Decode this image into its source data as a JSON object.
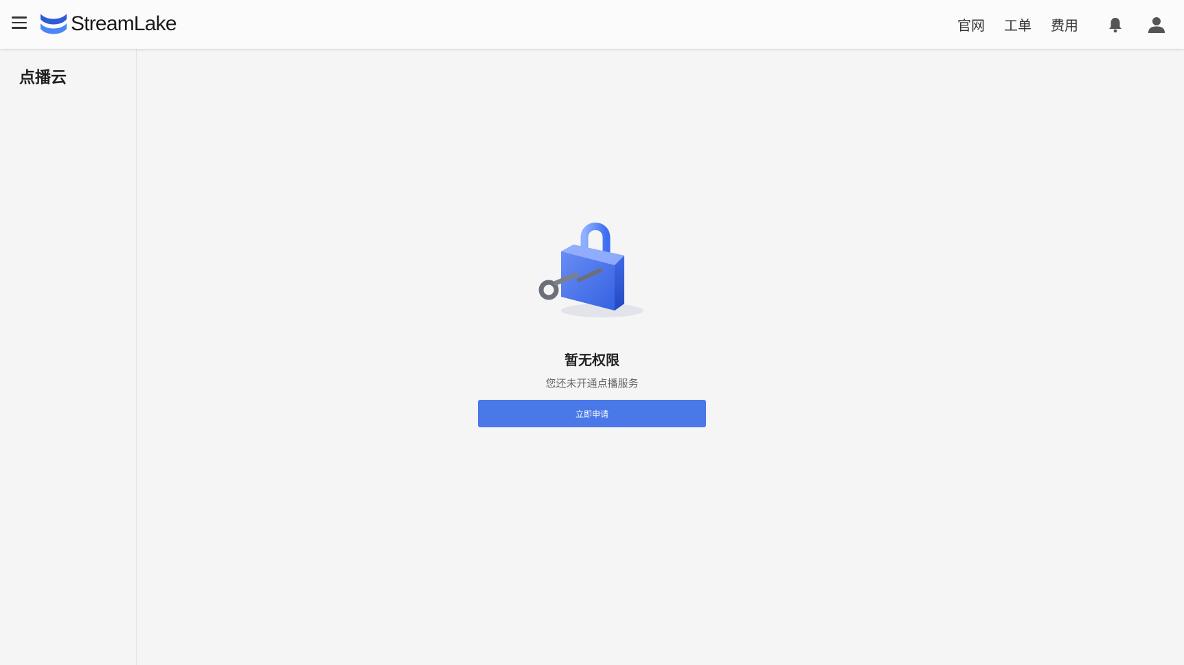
{
  "header": {
    "brand_name": "StreamLake",
    "nav": {
      "official_site": "官网",
      "tickets": "工单",
      "billing": "费用"
    }
  },
  "sidebar": {
    "title": "点播云"
  },
  "empty_state": {
    "title": "暂无权限",
    "description": "您还未开通点播服务",
    "apply_button_label": "立即申请"
  },
  "colors": {
    "accent": "#4a78e8",
    "brand": "#3b6cf0"
  },
  "icons": [
    "menu-icon",
    "streamlake-logo-icon",
    "bell-icon",
    "user-icon",
    "lock-illustration"
  ]
}
